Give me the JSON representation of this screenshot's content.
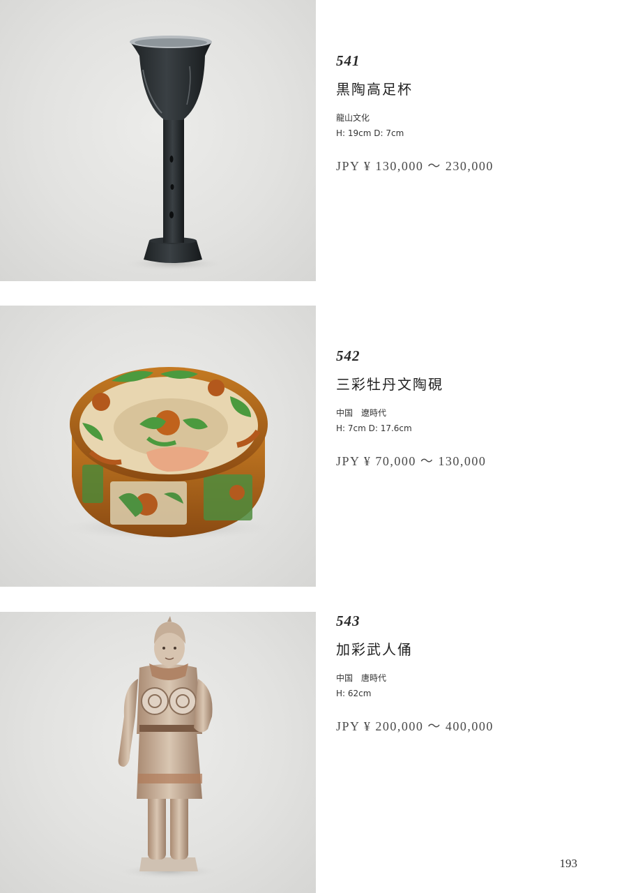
{
  "lots": [
    {
      "number": "541",
      "title": "黒陶高足杯",
      "origin": "龍山文化",
      "dimensions": "H: 19cm D: 7cm",
      "estimate": "JPY ¥ 130,000 ～ 230,000",
      "photo_icon": "black-pottery-stem-cup"
    },
    {
      "number": "542",
      "title": "三彩牡丹文陶硯",
      "origin": "中国　遼時代",
      "dimensions": "H: 7cm D: 17.6cm",
      "estimate": "JPY ¥ 70,000 ～ 130,000",
      "photo_icon": "sancai-peony-inkstone"
    },
    {
      "number": "543",
      "title": "加彩武人俑",
      "origin": "中国　唐時代",
      "dimensions": "H: 62cm",
      "estimate": "JPY ¥ 200,000 ～ 400,000",
      "photo_icon": "painted-warrior-figure"
    }
  ],
  "page_number": "193"
}
